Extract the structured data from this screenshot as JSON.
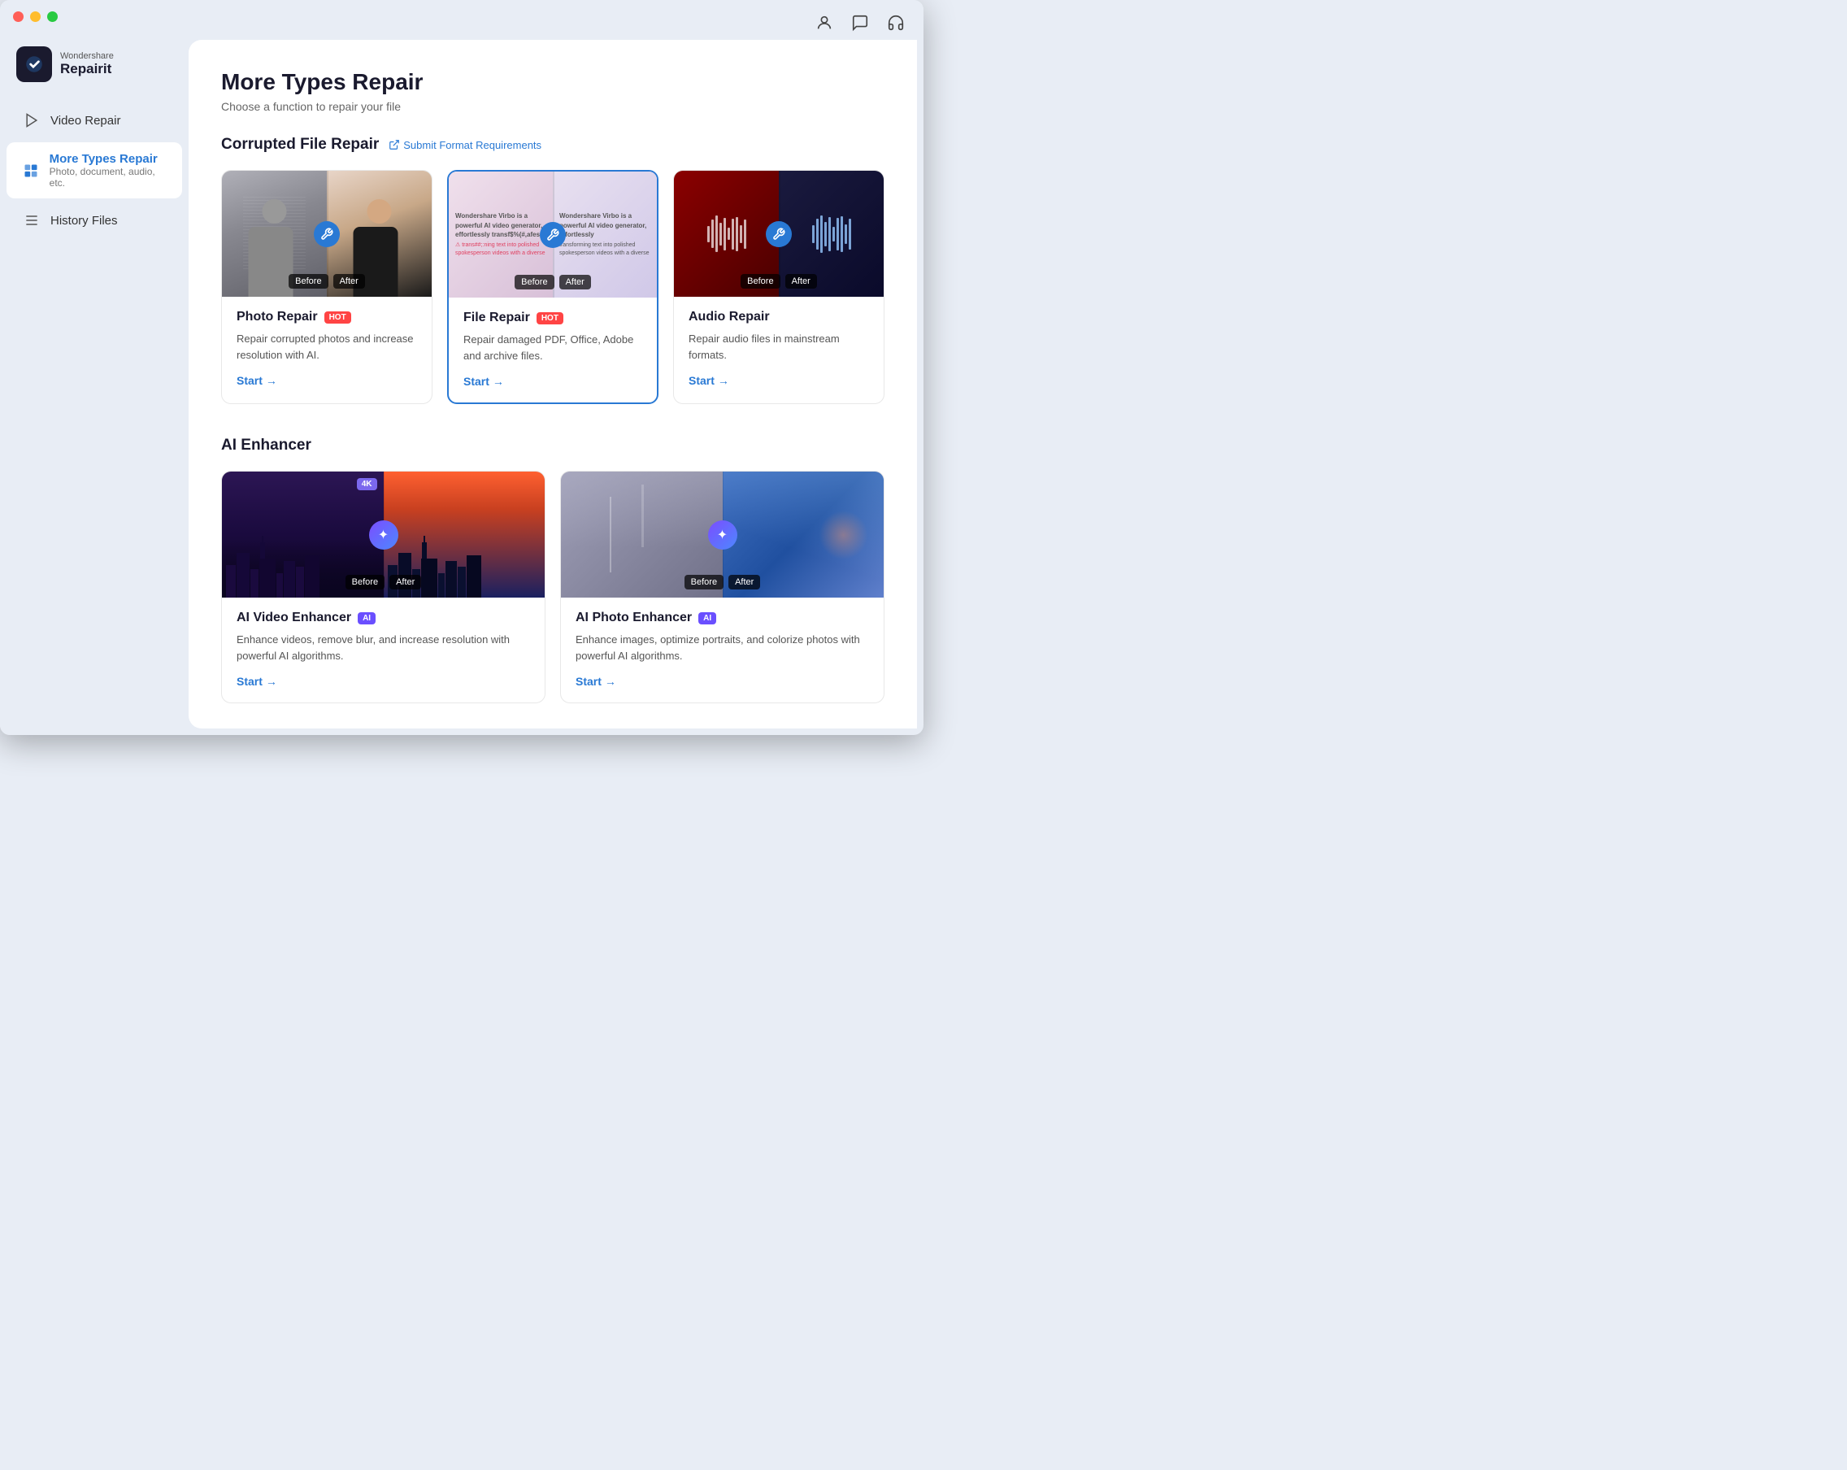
{
  "window": {
    "title": "Wondershare Repairit"
  },
  "titlebar": {
    "traffic_lights": [
      "red",
      "yellow",
      "green"
    ]
  },
  "header_icons": {
    "account": "👤",
    "chat": "💬",
    "headset": "🎧"
  },
  "sidebar": {
    "logo": {
      "brand": "Wondershare",
      "name": "Repairit"
    },
    "items": [
      {
        "id": "video-repair",
        "label": "Video Repair",
        "active": false
      },
      {
        "id": "more-types-repair",
        "label": "More Types Repair",
        "sub": "Photo, document, audio, etc.",
        "active": true
      },
      {
        "id": "history-files",
        "label": "History Files",
        "active": false
      }
    ]
  },
  "main": {
    "title": "More Types Repair",
    "subtitle": "Choose a function to repair your file",
    "sections": [
      {
        "id": "corrupted-file-repair",
        "title": "Corrupted File Repair",
        "submit_link": "Submit Format Requirements",
        "cards": [
          {
            "id": "photo-repair",
            "title": "Photo Repair",
            "badge": "HOT",
            "badge_type": "hot",
            "description": "Repair corrupted photos and increase resolution with AI.",
            "start_label": "Start",
            "selected": false
          },
          {
            "id": "file-repair",
            "title": "File Repair",
            "badge": "HOT",
            "badge_type": "hot",
            "description": "Repair damaged PDF, Office, Adobe and archive files.",
            "start_label": "Start",
            "selected": true
          },
          {
            "id": "audio-repair",
            "title": "Audio Repair",
            "badge": null,
            "description": "Repair audio files in mainstream formats.",
            "start_label": "Start",
            "selected": false
          }
        ]
      },
      {
        "id": "ai-enhancer",
        "title": "AI Enhancer",
        "cards": [
          {
            "id": "ai-video-enhancer",
            "title": "AI Video Enhancer",
            "badge": "AI",
            "badge_type": "ai",
            "description": "Enhance videos, remove blur, and increase resolution with powerful AI algorithms.",
            "start_label": "Start",
            "selected": false,
            "has_4k": true
          },
          {
            "id": "ai-photo-enhancer",
            "title": "AI Photo Enhancer",
            "badge": "AI",
            "badge_type": "ai",
            "description": "Enhance images, optimize portraits, and colorize photos with powerful AI algorithms.",
            "start_label": "Start",
            "selected": false
          }
        ]
      }
    ]
  }
}
